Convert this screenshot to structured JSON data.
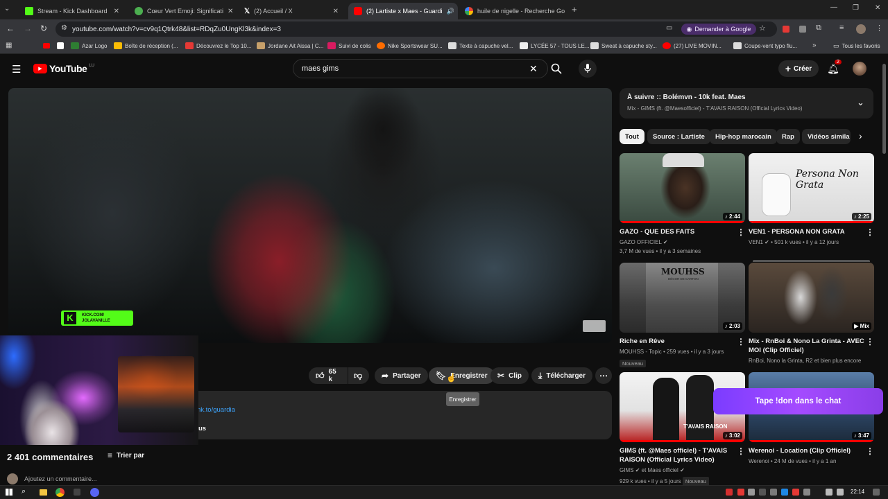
{
  "browser": {
    "tabs": [
      {
        "title": "Stream - Kick Dashboard",
        "color": "#53fc18"
      },
      {
        "title": "Cœur Vert Emoji: Significati",
        "color": "#4caf50"
      },
      {
        "title": "(2) Accueil / X",
        "color": "#ffffff"
      },
      {
        "title": "(2) Lartiste x Maes - Guardi",
        "color": "#ff0000"
      },
      {
        "title": "huile de nigelle - Recherche Go",
        "color": "#4285f4"
      }
    ],
    "url": "youtube.com/watch?v=cv9q1Qtrk48&list=RDqZu0UngKl3k&index=3",
    "google_button": "Demander à Google",
    "bookmarks": [
      "Azar Logo",
      "Boîte de réception (...",
      "Découvrez le Top 10...",
      "Jordane Ait Aissa | C...",
      "Suivi de colis",
      "Nike Sportswear SU...",
      "Texte à capuche vel...",
      "LYCÉE 57 - TOUS LE...",
      "Sweat à capuche sty...",
      "(27) LIVE MOVIN...",
      "Coupe-vent typo flu..."
    ],
    "all_favorites": "Tous les favoris"
  },
  "youtube": {
    "logo_text": "YouTube",
    "country": "LU",
    "search_value": "maes gims",
    "create_label": "Créer",
    "notif_count": "2"
  },
  "video": {
    "kick_badge_line1": "KICK.COM/",
    "kick_badge_line2": "JOLAVANILLE"
  },
  "actions": {
    "likes": "65 k",
    "share": "Partager",
    "save": "Enregistrer",
    "clip": "Clip",
    "download": "Télécharger",
    "tooltip": "Enregistrer"
  },
  "description": {
    "link_fragment": "nk.to/guardia",
    "text_fragment": "us"
  },
  "comments": {
    "count": "2 401 commentaires",
    "sort": "Trier par",
    "placeholder": "Ajoutez un commentaire..."
  },
  "playlist": {
    "title": "À suivre :: Bolémvn - 10k feat. Maes",
    "subtitle": "Mix - GIMS (ft. @Maesofficiel) - T'AVAIS RAISON (Official Lyrics Video)"
  },
  "chips": [
    "Tout",
    "Source : Lartiste",
    "Hip-hop marocain",
    "Rap",
    "Vidéos simila"
  ],
  "cards": [
    {
      "title": "GAZO - QUE DES FAITS",
      "channel": "GAZO OFFICIEL",
      "meta": "3,7 M de vues • il y a 3 semaines",
      "duration": "2:44",
      "badge": ""
    },
    {
      "title": "VEN1 - PERSONA NON GRATA",
      "channel": "VEN1",
      "meta": "501 k vues • il y a 12 jours",
      "duration": "2:25",
      "badge": "",
      "thumb_text": "Persona Non Grata"
    },
    {
      "title": "Riche en Rêve",
      "channel": "MOUHSS - Topic",
      "meta": "259 vues • il y a 3 jours",
      "duration": "2:03",
      "badge": "Nouveau",
      "thumb_text": "MOUHSS",
      "thumb_sub": "DÉCOR DE CARTON"
    },
    {
      "title": "Mix - RnBoi & Nono La Grinta - AVEC MOI (Clip Officiel)",
      "channel": "RnBoi, Nono la Grinta, R2 et bien plus encore",
      "meta": "",
      "duration": "Mix",
      "badge": ""
    },
    {
      "title": "GIMS (ft. @Maes officiel) - T'AVAIS RAISON (Official Lyrics Video)",
      "channel": "GIMS",
      "channel2": "et Maes officiel",
      "meta": "929 k vues • il y a 5 jours",
      "duration": "3:02",
      "badge": "Nouveau",
      "thumb_text": "T'AVAIS RAISON"
    },
    {
      "title": "Werenoi - Location (Clip Officiel)",
      "channel": "Werenoi",
      "meta": "24 M de vues • il y a 1 an",
      "duration": "3:47",
      "badge": ""
    }
  ],
  "chat_button": "Tape !don dans le chat",
  "taskbar": {
    "time": "22:14"
  }
}
